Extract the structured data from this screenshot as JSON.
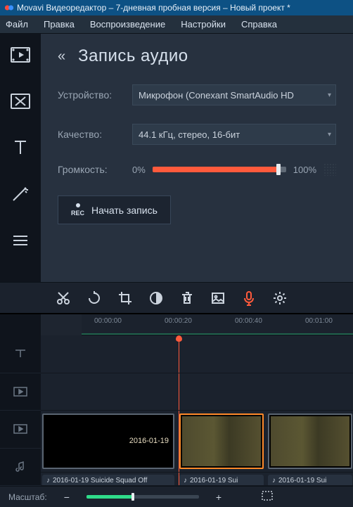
{
  "title": "Movavi Видеоредактор – 7-дневная пробная версия – Новый проект *",
  "menu": [
    "Файл",
    "Правка",
    "Воспроизведение",
    "Настройки",
    "Справка"
  ],
  "panel": {
    "title": "Запись аудио",
    "device_label": "Устройство:",
    "device_value": "Микрофон (Conexant SmartAudio HD",
    "quality_label": "Качество:",
    "quality_value": "44.1 кГц, стерео, 16-бит",
    "volume_label": "Громкость:",
    "vol_zero": "0%",
    "vol_full": "100%",
    "rec_label": "Начать запись",
    "rec_sub": "REC"
  },
  "ruler": [
    "00:00:00",
    "00:00:20",
    "00:00:40",
    "00:01:00"
  ],
  "clips": {
    "date": "2016-01-19",
    "a1": "2016-01-19 Suicide Squad Off",
    "a2": "2016-01-19 Sui",
    "a3": "2016-01-19 Sui"
  },
  "zoom_label": "Масштаб:"
}
